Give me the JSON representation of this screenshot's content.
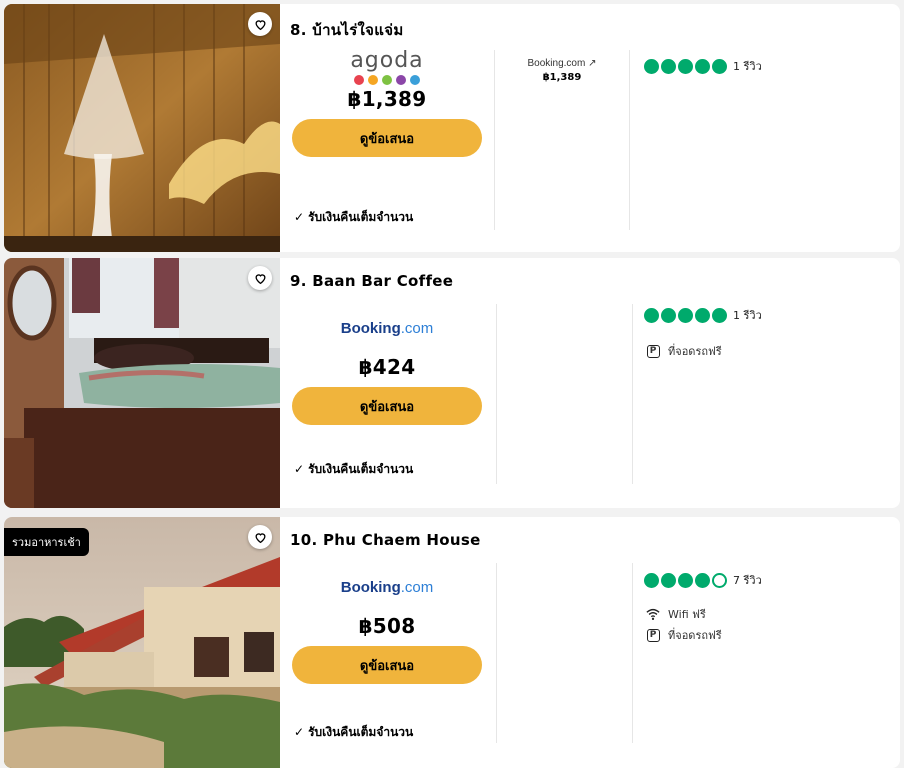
{
  "listings": [
    {
      "title": "8. บ้านไร่ใจแจ่ม",
      "offer": {
        "provider": "agoda",
        "price": "฿1,389",
        "button": "ดูข้อเสนอ"
      },
      "refund": "รับเงินคืนเต็มจำนวน",
      "alt_offer": {
        "provider": "Booking.com ↗",
        "price": "฿1,389"
      },
      "rating": {
        "bubbles": 5,
        "max": 5,
        "reviews": "1 รีวิว"
      },
      "amenities": []
    },
    {
      "title": "9. Baan Bar Coffee",
      "offer": {
        "provider": "Booking.com",
        "price": "฿424",
        "button": "ดูข้อเสนอ"
      },
      "refund": "รับเงินคืนเต็มจำนวน",
      "rating": {
        "bubbles": 5,
        "max": 5,
        "reviews": "1 รีวิว"
      },
      "amenities": [
        {
          "icon": "parking-icon",
          "label": "ที่จอดรถฟรี"
        }
      ]
    },
    {
      "title": "10. Phu Chaem House",
      "badge": "รวมอาหารเช้า",
      "offer": {
        "provider": "Booking.com",
        "price": "฿508",
        "button": "ดูข้อเสนอ"
      },
      "refund": "รับเงินคืนเต็มจำนวน",
      "rating": {
        "bubbles": 4,
        "max": 5,
        "reviews": "7 รีวิว"
      },
      "amenities": [
        {
          "icon": "wifi-icon",
          "label": "Wifi ฟรี"
        },
        {
          "icon": "parking-icon",
          "label": "ที่จอดรถฟรี"
        }
      ]
    }
  ],
  "logos": {
    "agoda_text": "agoda",
    "booking_name": "Booking",
    "booking_suffix": ".com",
    "parking_letter": "P"
  },
  "colors": {
    "button": "#f0b43c",
    "rating_green": "#00aa6c",
    "booking_blue": "#1a3f8a",
    "agoda_dots": [
      "#e8424f",
      "#f5a623",
      "#7ec242",
      "#8b46a8",
      "#3a9fd9"
    ]
  }
}
